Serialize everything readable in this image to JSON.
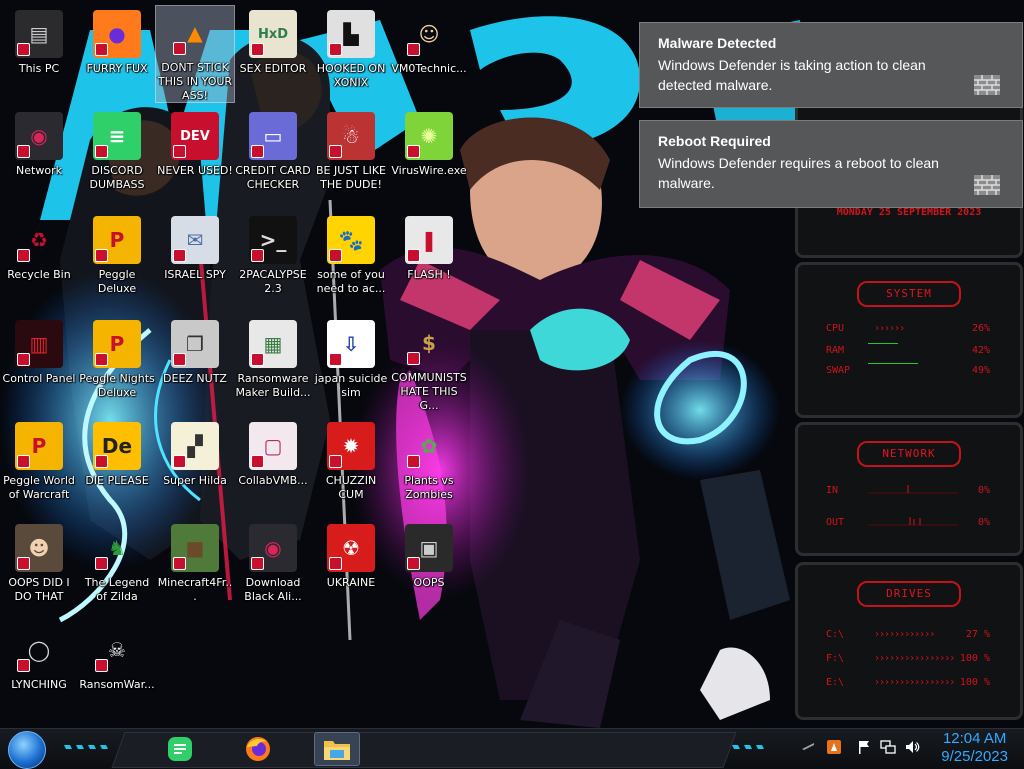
{
  "desktop": {
    "icons": [
      {
        "label": "This PC",
        "icon": "computer-icon"
      },
      {
        "label": "FURRY FUX",
        "icon": "firefox-icon"
      },
      {
        "label": "DONT STICK THIS IN YOUR ASS!",
        "icon": "vlc-icon"
      },
      {
        "label": "SEX EDITOR",
        "icon": "hex-editor-icon"
      },
      {
        "label": "HOOKED ON XONIX",
        "icon": "xonix-icon"
      },
      {
        "label": "VM0Technic...",
        "icon": "technician-icon"
      },
      {
        "label": "Network",
        "icon": "network-orb-icon"
      },
      {
        "label": "DISCORD DUMBASS",
        "icon": "discord-icon"
      },
      {
        "label": "NEVER USED!",
        "icon": "devcpp-icon"
      },
      {
        "label": "CREDIT CARD CHECKER",
        "icon": "credit-card-icon"
      },
      {
        "label": "BE JUST LIKE THE DUDE!",
        "icon": "santa-icon"
      },
      {
        "label": "VirusWire.exe",
        "icon": "lime-icon"
      },
      {
        "label": "Recycle Bin",
        "icon": "recycle-bin-icon"
      },
      {
        "label": "Peggle Deluxe",
        "icon": "peggle-icon"
      },
      {
        "label": "ISRAEL SPY",
        "icon": "spy-icon"
      },
      {
        "label": "2PACALYPSE 2.3",
        "icon": "terminal-icon"
      },
      {
        "label": "some of you need to ac...",
        "icon": "dog-icon"
      },
      {
        "label": "FLASH !",
        "icon": "flash-icon"
      },
      {
        "label": "Control Panel",
        "icon": "control-panel-icon"
      },
      {
        "label": "Peggle Nights Deluxe",
        "icon": "peggle-icon"
      },
      {
        "label": "DEEZ NUTZ",
        "icon": "windows-stack-icon"
      },
      {
        "label": "Ransomware Maker Build...",
        "icon": "app-window-icon"
      },
      {
        "label": "japan suicide sim",
        "icon": "document-icon"
      },
      {
        "label": "COMMUNISTS HATE THIS G...",
        "icon": "money-bag-icon"
      },
      {
        "label": "Peggle World of Warcraft",
        "icon": "peggle-icon"
      },
      {
        "label": "DIE PLEASE",
        "icon": "de-icon"
      },
      {
        "label": "Super Hilda",
        "icon": "pixel-cat-icon"
      },
      {
        "label": "CollabVMB...",
        "icon": "collabvm-icon"
      },
      {
        "label": "CHUZZIN CUM",
        "icon": "chuzzle-icon"
      },
      {
        "label": "Plants vs Zombies",
        "icon": "plant-icon"
      },
      {
        "label": "OOPS DID I DO THAT",
        "icon": "portrait-icon"
      },
      {
        "label": "The Legend of Zilda",
        "icon": "zelda-icon"
      },
      {
        "label": "Minecraft4Fr...",
        "icon": "minecraft-icon"
      },
      {
        "label": "Download Black Ali...",
        "icon": "network-orb-icon"
      },
      {
        "label": "UKRAINE",
        "icon": "radiation-icon"
      },
      {
        "label": "OOPS",
        "icon": "window-icon"
      },
      {
        "label": "LYNCHING",
        "icon": "noose-icon"
      },
      {
        "label": "RansomWar...",
        "icon": "skull-icon"
      }
    ]
  },
  "notifications": [
    {
      "title": "Malware Detected",
      "body": "Windows Defender is taking action to clean detected malware.",
      "icon": "defender-wall-icon"
    },
    {
      "title": "Reboot Required",
      "body": "Windows Defender requires a reboot to clean malware.",
      "icon": "defender-wall-icon"
    }
  ],
  "widget": {
    "date_text": "Monday 25 September 2023",
    "system": {
      "title": "System",
      "rows": [
        {
          "key": "CPU",
          "value": "26%"
        },
        {
          "key": "RAM",
          "value": "42%"
        },
        {
          "key": "SWAP",
          "value": "49%"
        }
      ]
    },
    "network": {
      "title": "Network",
      "rows": [
        {
          "key": "IN",
          "value": "0%"
        },
        {
          "key": "OUT",
          "value": "0%"
        }
      ]
    },
    "drives": {
      "title": "Drives",
      "rows": [
        {
          "key": "C:\\",
          "value": "27 %"
        },
        {
          "key": "F:\\",
          "value": "100 %"
        },
        {
          "key": "E:\\",
          "value": "100 %"
        }
      ]
    },
    "accent_color": "#d0141c"
  },
  "taskbar": {
    "apps": [
      {
        "name": "discord-icon",
        "active": false
      },
      {
        "name": "firefox-icon",
        "active": false
      },
      {
        "name": "file-explorer-icon",
        "active": true
      }
    ],
    "tray": [
      "antivirus-icon",
      "flag-icon",
      "network-icon",
      "volume-icon"
    ],
    "time": "12:04 AM",
    "date": "9/25/2023"
  }
}
